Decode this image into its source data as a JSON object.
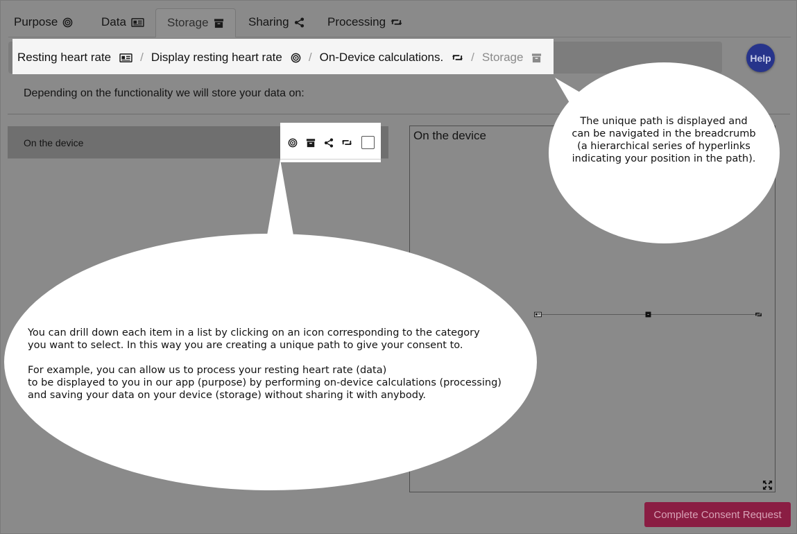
{
  "tabs": [
    {
      "label": "Purpose",
      "icon": "target-icon"
    },
    {
      "label": "Data",
      "icon": "id-card-icon"
    },
    {
      "label": "Storage",
      "icon": "archive-icon",
      "active": true
    },
    {
      "label": "Sharing",
      "icon": "share-icon"
    },
    {
      "label": "Processing",
      "icon": "retweet-icon"
    }
  ],
  "breadcrumb": [
    {
      "label": "Resting heart rate",
      "icon": "id-card-icon"
    },
    {
      "label": "Display resting heart rate",
      "icon": "target-icon"
    },
    {
      "label": "On-Device calculations.",
      "icon": "retweet-icon"
    },
    {
      "label": "Storage",
      "icon": "archive-icon",
      "current": true
    }
  ],
  "breadcrumb_separator": "/",
  "help_label": "Help",
  "description": "Depending on the functionality we will store your data on:",
  "list": {
    "items": [
      {
        "label": "On the device",
        "icons": [
          "target-icon",
          "archive-icon",
          "share-icon",
          "retweet-icon"
        ],
        "checked": false
      }
    ]
  },
  "panel": {
    "title": "On the device"
  },
  "complete_button": "Complete Consent Request",
  "bubbles": {
    "top": "The unique path is displayed and\ncan be navigated in the breadcrumb\n(a hierarchical series of hyperlinks\nindicating your position in the path).",
    "main_p1": "You can drill down each item in a list by clicking on an icon corresponding to the category\nyou want to select. In this way you are creating a unique path to give your consent to.",
    "main_p2": "For example, you can allow us to process your resting heart rate (data)\nto be displayed to you in our app (purpose) by performing on-device calculations (processing)\nand saving your data on your device (storage) without sharing it with anybody."
  },
  "colors": {
    "help_button": "#27348b",
    "complete_button": "#8a1d43",
    "overlay_background": "#8a8a8a"
  }
}
